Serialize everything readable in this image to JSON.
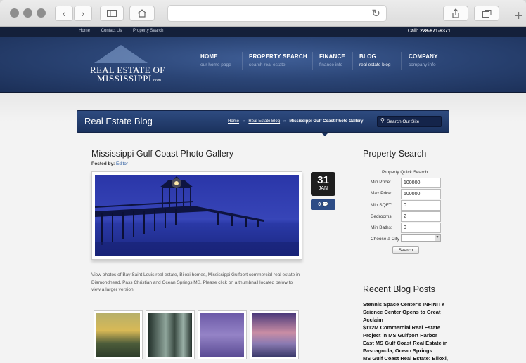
{
  "site": {
    "top_links": [
      "Home",
      "Contact Us",
      "Property Search"
    ],
    "phone": "Call: 228-671-9371",
    "logo": {
      "line1": "REAL ESTATE OF",
      "line2": "MISSISSIPPI",
      "line3": ".com"
    },
    "nav": [
      {
        "title": "HOME",
        "sub": "our home page"
      },
      {
        "title": "PROPERTY SEARCH",
        "sub": "search real estate"
      },
      {
        "title": "FINANCE",
        "sub": "finance info"
      },
      {
        "title": "BLOG",
        "sub": "real estate blog"
      },
      {
        "title": "COMPANY",
        "sub": "company info"
      }
    ],
    "active_nav": "BLOG"
  },
  "page": {
    "section_title": "Real Estate Blog",
    "breadcrumbs": [
      "Home",
      "Real Estate Blog",
      "Mississippi Gulf Coast Photo Gallery"
    ],
    "search_placeholder": "Search Our Site"
  },
  "post": {
    "title": "Mississippi Gulf Coast Photo Gallery",
    "posted_by_label": "Posted by:",
    "author": "Editor",
    "day": "31",
    "month": "JAN",
    "comments": "0",
    "description": "View photos of Bay Saint Louis real estate, Biloxi homes, Mississippi Gulfport commercial real estate in Diamondhead, Pass Christian and Ocean Springs MS. Please click on a thumbnail located below to view a larger version."
  },
  "sidebar": {
    "search_title": "Property Search",
    "quick_title": "Property Quick Search",
    "fields": [
      {
        "label": "Min Price:",
        "value": "100000"
      },
      {
        "label": "Max Price:",
        "value": "500000"
      },
      {
        "label": "Min SQFT:",
        "value": "0"
      },
      {
        "label": "Bedrooms:",
        "value": "2"
      },
      {
        "label": "Min Baths:",
        "value": "0"
      }
    ],
    "city_label": "Choose a City",
    "search_button": "Search",
    "recent_title": "Recent Blog Posts",
    "recent_posts": [
      "Stennis Space Center's INFINITY Science Center Opens to Great Acclaim",
      "$112M Commercial Real Estate Project in MS Gulfport Harbor",
      "East MS Gulf Coast Real Estate in Pascagoula, Ocean Springs",
      "MS Gulf Coast Real Estate: Biloxi,"
    ]
  },
  "colors": {
    "header": "#2b4576",
    "titlebar": "#1b325e",
    "link": "#2d5da0"
  },
  "icons": [
    "back-icon",
    "forward-icon",
    "sidebar-icon",
    "home-icon",
    "reload-icon",
    "share-icon",
    "tabs-icon",
    "plus-icon",
    "search-icon",
    "comment-icon"
  ]
}
